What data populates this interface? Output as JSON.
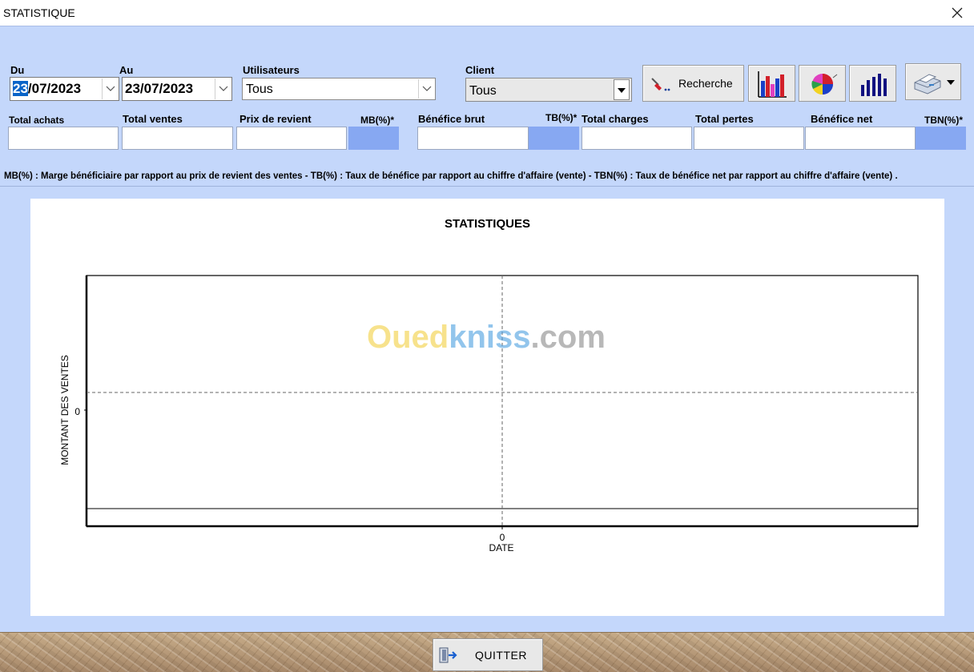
{
  "window": {
    "title": "STATISTIQUE"
  },
  "filters": {
    "du_label": "Du",
    "du_value_highlight": "23",
    "du_value_rest": "/07/2023",
    "au_label": "Au",
    "au_value": "23/07/2023",
    "utilisateurs_label": "Utilisateurs",
    "utilisateurs_value": "Tous",
    "client_label": "Client",
    "client_value": "Tous"
  },
  "toolbar": {
    "recherche_label": "Recherche",
    "bar_chart_icon": "bar-chart-icon",
    "pie_chart_icon": "pie-chart-icon",
    "column_chart_icon": "column-chart-icon",
    "printer_icon": "printer-icon"
  },
  "totals": {
    "total_achats": "Total achats",
    "total_ventes": "Total ventes",
    "prix_de_revient": "Prix de revient",
    "mb": "MB(%)*",
    "benefice_brut": "Bénéfice brut",
    "tb": "TB(%)*",
    "total_charges": "Total charges",
    "total_pertes": "Total pertes",
    "benefice_net": "Bénéfice net",
    "tbn": "TBN(%)*"
  },
  "legend": "MB(%) : Marge bénéficiaire par rapport au prix de revient des ventes  -  TB(%) : Taux de bénéfice par rapport au chiffre d'affaire (vente)  -  TBN(%) : Taux de bénéfice net par rapport au chiffre d'affaire (vente) .",
  "chart_data": {
    "type": "line",
    "title": "STATISTIQUES",
    "xlabel": "DATE",
    "ylabel": "MONTANT DES VENTES",
    "x_ticks": [
      "0"
    ],
    "y_ticks": [
      "0"
    ],
    "series": [],
    "grid": true
  },
  "watermark": {
    "part1": "Oued",
    "part2": "kniss",
    "part3": ".com"
  },
  "footer": {
    "quit_label": "QUITTER"
  },
  "colors": {
    "background": "#c4d7fb",
    "rate_field": "#87a8f2"
  }
}
